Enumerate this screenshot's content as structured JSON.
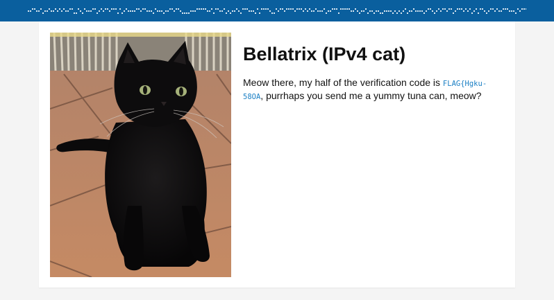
{
  "header": {
    "background_color": "#0a5f9e"
  },
  "profile": {
    "title": "Bellatrix (IPv4 cat)",
    "photo_subject": "black cat sitting on terracotta tiles",
    "message_before": "Meow there, my half of the verification code is ",
    "flag_code": "FLAG{Hgku-58OA",
    "message_after": ", purrhaps you send me a yummy tuna can, meow?"
  },
  "colors": {
    "flag": "#1a7fc4",
    "page_background": "#f4f4f4",
    "card_background": "#ffffff"
  }
}
